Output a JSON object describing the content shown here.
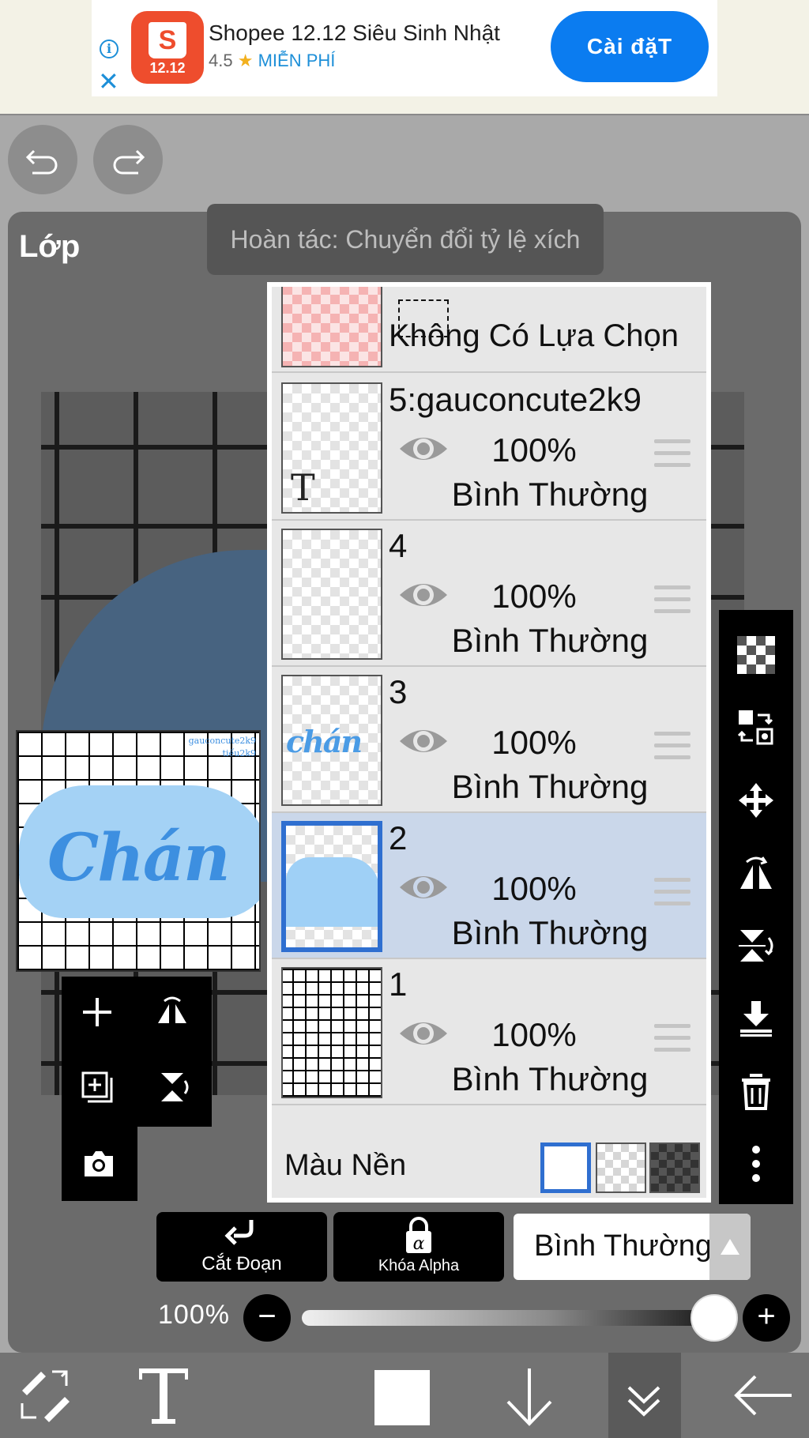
{
  "ad": {
    "title": "Shopee 12.12 Siêu Sinh Nhật",
    "rating": "4.5",
    "star": "★",
    "free_label": "MIỄN PHÍ",
    "logo_text": "12.12",
    "logo_letter": "S",
    "install_label": "Cài đặT",
    "info_glyph": "i",
    "close_glyph": "✕"
  },
  "panel": {
    "title": "Lớp"
  },
  "toast": {
    "text": "Hoàn tác: Chuyển đổi tỷ lệ xích"
  },
  "preview": {
    "word": "Chán",
    "watermark_line1": "gauconcute2k9",
    "watermark_line2": "tiếu2k9"
  },
  "layers": {
    "selection_layer": {
      "label": "Không Có Lựa Chọn"
    },
    "items": [
      {
        "name": "5:gauconcute2k9",
        "opacity": "100%",
        "blend": "Bình Thường",
        "thumb_letter": "T"
      },
      {
        "name": "4",
        "opacity": "100%",
        "blend": "Bình Thường"
      },
      {
        "name": "3",
        "opacity": "100%",
        "blend": "Bình Thường",
        "thumb_word": "chán"
      },
      {
        "name": "2",
        "opacity": "100%",
        "blend": "Bình Thường"
      },
      {
        "name": "1",
        "opacity": "100%",
        "blend": "Bình Thường"
      }
    ],
    "selected_layer": "2",
    "background_label": "Màu Nền"
  },
  "controls": {
    "clip_label": "Cắt Đoạn",
    "alpha_lock_label": "Khóa Alpha",
    "blend_mode": "Bình Thường",
    "opacity_label": "100%",
    "opacity_value": 1.0,
    "minus": "−",
    "plus": "+"
  },
  "colors": {
    "accent": "#2f6fd0",
    "install_button": "#0b7cf0",
    "selected_row": "#cad7ea",
    "brand_shopee": "#ee4d2d"
  },
  "icons": {
    "undo": "undo-icon",
    "redo": "redo-icon",
    "right_toolbar": [
      "transparency-icon",
      "layer-swap-icon",
      "move-icon",
      "flip-horizontal-icon",
      "flip-vertical-icon",
      "merge-down-icon",
      "trash-icon",
      "more-icon"
    ],
    "bottom_bar": [
      "transform-icon",
      "text-tool-icon",
      "color-swatch-icon",
      "download-icon",
      "collapse-icon",
      "back-arrow-icon"
    ]
  }
}
